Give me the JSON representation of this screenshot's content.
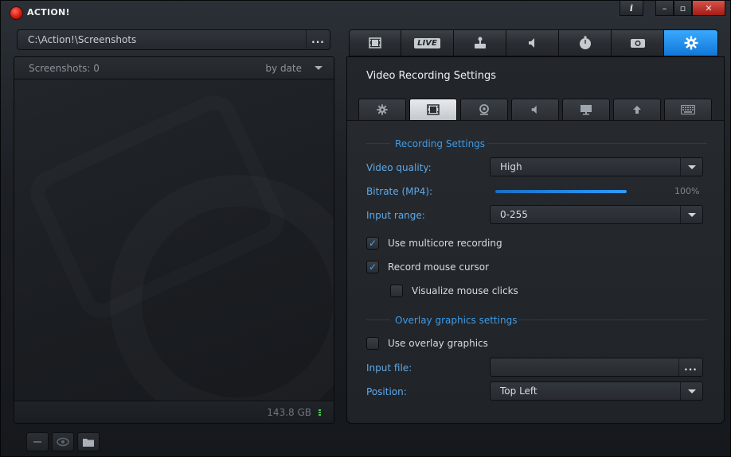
{
  "app": {
    "title": "ACTION!"
  },
  "window_controls": {
    "info": "i",
    "minimize": "–",
    "maximize": "▫",
    "close": "✕"
  },
  "path_bar": {
    "path": "C:\\Action!\\Screenshots",
    "browse_label": "..."
  },
  "screenshots": {
    "count_label": "Screenshots: 0",
    "sort_label": "by date",
    "disk_free": "143.8 GB"
  },
  "main_tabs": [
    {
      "name": "video",
      "icon": "film-icon"
    },
    {
      "name": "live",
      "icon": "live-icon",
      "label": "LIVE"
    },
    {
      "name": "game",
      "icon": "joystick-icon"
    },
    {
      "name": "audio",
      "icon": "speaker-icon"
    },
    {
      "name": "timer",
      "icon": "stopwatch-icon"
    },
    {
      "name": "screenshot",
      "icon": "camera-icon"
    },
    {
      "name": "settings",
      "icon": "gear-icon",
      "active": true
    }
  ],
  "settings": {
    "title": "Video Recording Settings",
    "sub_tabs": [
      "gear-icon",
      "film-icon",
      "webcam-icon",
      "speaker-icon",
      "monitor-icon",
      "upload-icon",
      "keyboard-icon"
    ],
    "recording_section": "Recording Settings",
    "video_quality": {
      "label": "Video quality:",
      "value": "High"
    },
    "bitrate": {
      "label": "Bitrate (MP4):",
      "value_text": "100%",
      "level": 1.0
    },
    "input_range": {
      "label": "Input range:",
      "value": "0-255"
    },
    "multicore": {
      "label": "Use multicore recording",
      "checked": true
    },
    "mouse_cursor": {
      "label": "Record mouse cursor",
      "checked": true
    },
    "mouse_clicks": {
      "label": "Visualize mouse clicks",
      "checked": false
    },
    "overlay_section": "Overlay graphics settings",
    "overlay": {
      "label": "Use overlay graphics",
      "checked": false
    },
    "input_file": {
      "label": "Input file:",
      "value": "",
      "browse_label": "..."
    },
    "position": {
      "label": "Position:",
      "value": "Top Left"
    }
  },
  "accent_color": "#1a8cf0"
}
